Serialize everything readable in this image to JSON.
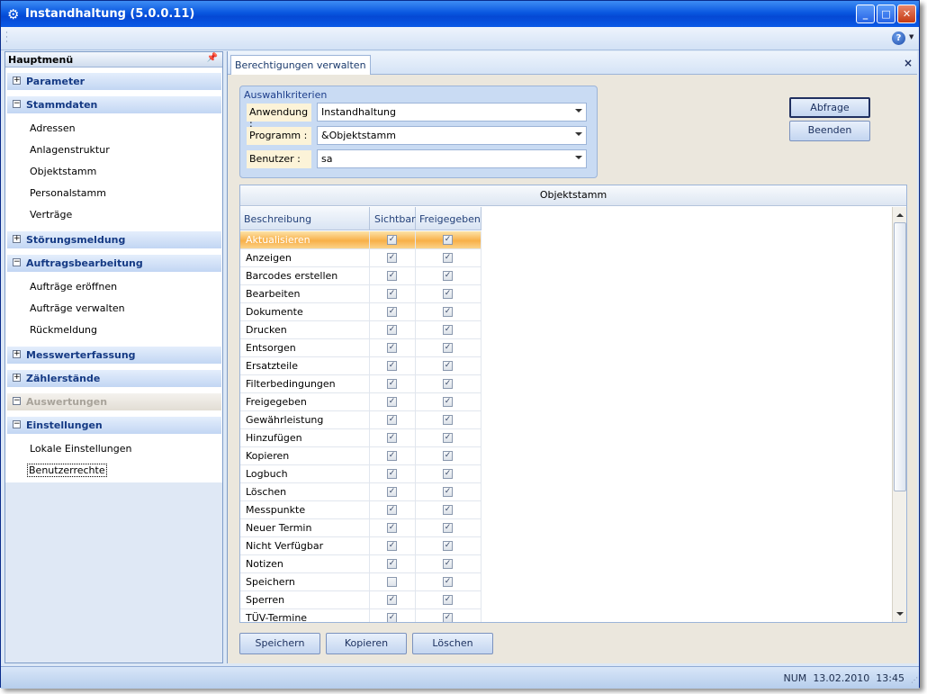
{
  "window": {
    "title": "Instandhaltung (5.0.0.11)",
    "min": "_",
    "max": "□",
    "close": "✕"
  },
  "toolbar": {
    "help": "?"
  },
  "sidebar": {
    "title": "Hauptmenü",
    "groups": [
      {
        "label": "Parameter",
        "expanded": false
      },
      {
        "label": "Stammdaten",
        "expanded": true,
        "items": [
          "Adressen",
          "Anlagenstruktur",
          "Objektstamm",
          "Personalstamm",
          "Verträge"
        ]
      },
      {
        "label": "Störungsmeldung",
        "expanded": false
      },
      {
        "label": "Auftragsbearbeitung",
        "expanded": true,
        "items": [
          "Aufträge eröffnen",
          "Aufträge verwalten",
          "Rückmeldung"
        ]
      },
      {
        "label": "Messwerterfassung",
        "expanded": false
      },
      {
        "label": "Zählerstände",
        "expanded": false
      },
      {
        "label": "Auswertungen",
        "expanded": false,
        "disabled": true
      },
      {
        "label": "Einstellungen",
        "expanded": true,
        "items": [
          "Lokale Einstellungen",
          "Benutzerrechte"
        ]
      }
    ],
    "selected_item": "Benutzerrechte"
  },
  "tab": {
    "label": "Berechtigungen verwalten",
    "close": "×"
  },
  "criteria": {
    "title": "Auswahlkriterien",
    "fields": [
      {
        "label": "Anwendung :",
        "value": "Instandhaltung"
      },
      {
        "label": "Programm :",
        "value": "&Objektstamm"
      },
      {
        "label": "Benutzer :",
        "value": "sa"
      }
    ]
  },
  "buttons": {
    "abfrage": "Abfrage",
    "beenden": "Beenden",
    "speichern": "Speichern",
    "kopieren": "Kopieren",
    "loeschen": "Löschen"
  },
  "grid": {
    "title": "Objektstamm",
    "columns": [
      "Beschreibung",
      "Sichtbar",
      "Freigegeben"
    ],
    "rows": [
      {
        "name": "Aktualisieren",
        "sichtbar": true,
        "freigegeben": true
      },
      {
        "name": "Anzeigen",
        "sichtbar": true,
        "freigegeben": true
      },
      {
        "name": "Barcodes erstellen",
        "sichtbar": true,
        "freigegeben": true
      },
      {
        "name": "Bearbeiten",
        "sichtbar": true,
        "freigegeben": true
      },
      {
        "name": "Dokumente",
        "sichtbar": true,
        "freigegeben": true
      },
      {
        "name": "Drucken",
        "sichtbar": true,
        "freigegeben": true
      },
      {
        "name": "Entsorgen",
        "sichtbar": true,
        "freigegeben": true
      },
      {
        "name": "Ersatzteile",
        "sichtbar": true,
        "freigegeben": true
      },
      {
        "name": "Filterbedingungen",
        "sichtbar": true,
        "freigegeben": true
      },
      {
        "name": "Freigegeben",
        "sichtbar": true,
        "freigegeben": true
      },
      {
        "name": "Gewährleistung",
        "sichtbar": true,
        "freigegeben": true
      },
      {
        "name": "Hinzufügen",
        "sichtbar": true,
        "freigegeben": true
      },
      {
        "name": "Kopieren",
        "sichtbar": true,
        "freigegeben": true
      },
      {
        "name": "Logbuch",
        "sichtbar": true,
        "freigegeben": true
      },
      {
        "name": "Löschen",
        "sichtbar": true,
        "freigegeben": true
      },
      {
        "name": "Messpunkte",
        "sichtbar": true,
        "freigegeben": true
      },
      {
        "name": "Neuer Termin",
        "sichtbar": true,
        "freigegeben": true
      },
      {
        "name": "Nicht Verfügbar",
        "sichtbar": true,
        "freigegeben": true
      },
      {
        "name": "Notizen",
        "sichtbar": true,
        "freigegeben": true
      },
      {
        "name": "Speichern",
        "sichtbar": false,
        "freigegeben": true
      },
      {
        "name": "Sperren",
        "sichtbar": true,
        "freigegeben": true
      },
      {
        "name": "TÜV-Termine übernehmen",
        "sichtbar": true,
        "freigegeben": true
      }
    ],
    "active_row": "Aktualisieren"
  },
  "status": {
    "num": "NUM",
    "date": "13.02.2010",
    "time": "13:45"
  },
  "colors": {
    "accent": "#0a58e0",
    "panel": "#ebe7dd",
    "highlight": "#f8b048"
  }
}
